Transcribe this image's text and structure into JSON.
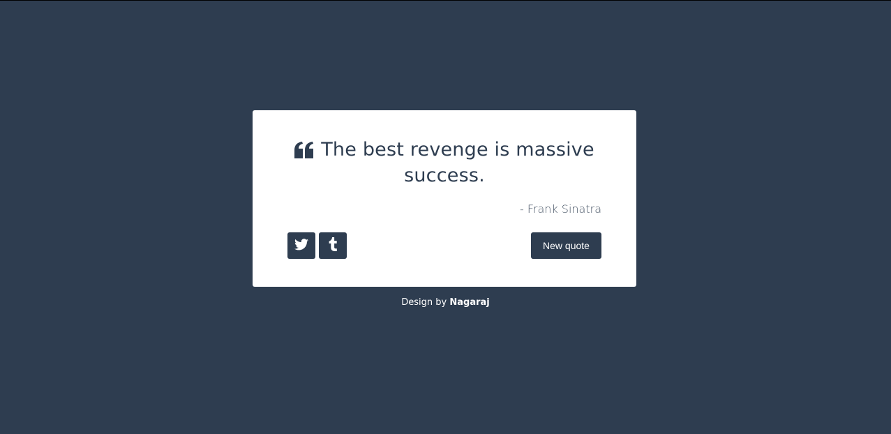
{
  "quote": {
    "text": "The best revenge is massive success.",
    "author": "- Frank Sinatra",
    "icon": "quote-left-icon"
  },
  "actions": {
    "twitter_icon": "twitter-icon",
    "tumblr_icon": "tumblr-icon",
    "new_quote_label": "New quote"
  },
  "footer": {
    "prefix": "Design by",
    "author_link": "Nagaraj"
  },
  "colors": {
    "background": "#2e3d50",
    "card": "#ffffff",
    "accent": "#2e3d50"
  }
}
